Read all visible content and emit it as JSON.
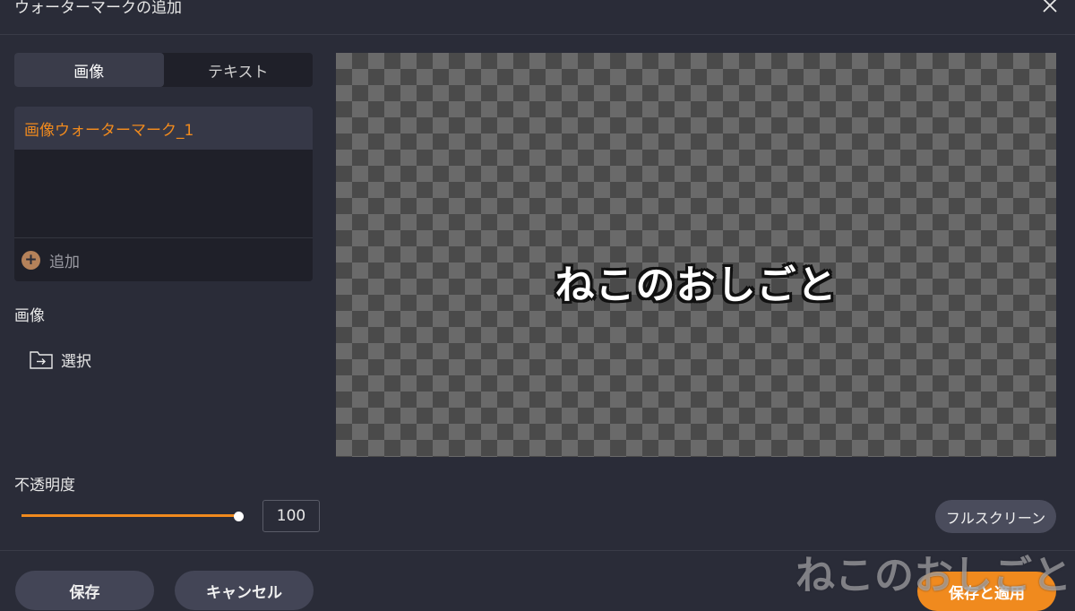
{
  "window": {
    "title": "ウォーターマークの追加"
  },
  "tabs": [
    {
      "label": "画像",
      "active": true
    },
    {
      "label": "テキスト",
      "active": false
    }
  ],
  "watermark_list": {
    "items": [
      {
        "label": "画像ウォーターマーク_1",
        "selected": true
      }
    ],
    "add_label": "追加"
  },
  "image_section": {
    "label": "画像",
    "select_label": "選択"
  },
  "opacity": {
    "label": "不透明度",
    "value": "100",
    "percent": 100
  },
  "preview": {
    "watermark_text": "ねこのおしごと"
  },
  "buttons": {
    "fullscreen": "フルスクリーン",
    "save": "保存",
    "cancel": "キャンセル",
    "save_apply": "保存と適用"
  },
  "overlay_mark": "ねこのおしごと",
  "colors": {
    "accent": "#f08a1e",
    "background": "#2a2c38",
    "panel": "#1f2029"
  },
  "icons": {
    "close": "close-icon",
    "add": "plus-circle-icon",
    "folder": "folder-import-icon"
  }
}
